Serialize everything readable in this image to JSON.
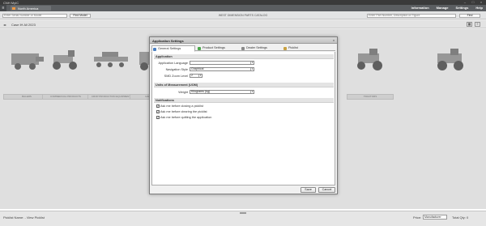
{
  "titlebar": {
    "app_title": "CNH MyIC"
  },
  "navbar": {
    "home_icon": "home-icon",
    "region": "North America",
    "menu": [
      "Information",
      "Manage",
      "Settings",
      "Help"
    ]
  },
  "searchbar": {
    "left_placeholder": "Enter Serial Number or Model",
    "left_button": "Find Model",
    "center_title": "WEST DIMENSION PARTS CATALOG",
    "right_placeholder": "Enter Part Number, Description or Figure",
    "right_button": "Find"
  },
  "breadcrumb": {
    "path": "Case IH All 2023"
  },
  "catalog": {
    "items": [
      {
        "label": "BALERS"
      },
      {
        "label": "COMMERCIAL PRODUCTS"
      },
      {
        "label": "CROP PRODUCTION EQUIPMENT"
      },
      {
        "label": "HARVESTING"
      },
      {
        "label": "TRACTORS"
      }
    ]
  },
  "dialog": {
    "title": "Application Settings",
    "close": "x",
    "tabs": [
      "General Settings",
      "Product Settings",
      "Dealer Settings",
      "Picklist"
    ],
    "sections": {
      "application": "Application",
      "units": "Units of Measurement (UOM)",
      "notifications": "Notifications"
    },
    "fields": {
      "language_label": "Application Language",
      "language_value": "",
      "navstyle_label": "Navigation Style",
      "navstyle_value": "Graphical",
      "zoom_label": "SMD Zoom Level",
      "zoom_value": "2",
      "weight_label": "Weight",
      "weight_value": "Kilograms (kg)"
    },
    "notifications": [
      {
        "label": "Ask me before closing a picklist",
        "checked": true
      },
      {
        "label": "Ask me before clearing the picklist",
        "checked": true
      },
      {
        "label": "Ask me before quitting the application",
        "checked": true
      }
    ],
    "save": "Save",
    "cancel": "Cancel"
  },
  "statusbar": {
    "left": "Picklist Name: - View Picklist",
    "price_label": "Price:",
    "price_value": "Manufacturer",
    "total": "Total Qty: 0"
  },
  "colors": {
    "nav_bg": "#5b5e61",
    "titlebar_bg": "#3a3a3a",
    "dialog_bg": "#f0f0f0"
  }
}
